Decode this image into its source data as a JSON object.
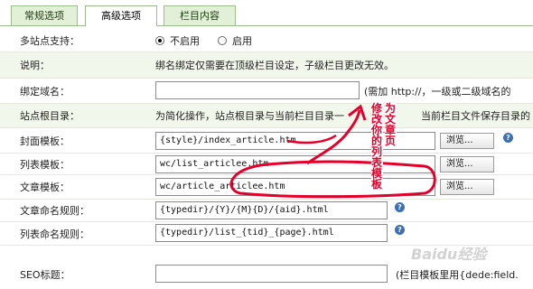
{
  "tabs": [
    "常规选项",
    "高级选项",
    "栏目内容"
  ],
  "rows": {
    "multisite": {
      "label": "多站点支持：",
      "option_off": "不启用",
      "option_on": "启用"
    },
    "note": {
      "label": "说明：",
      "text": "绑名绑定仅需要在顶级栏目设定，子级栏目更改无效。"
    },
    "bind_domain": {
      "label": "绑定域名：",
      "value": "",
      "hint": "(需加 http://，一级或二级域名的"
    },
    "site_root": {
      "label": "站点根目录：",
      "text": "为简化操作，站点根目录与当前栏目目录一",
      "text_right": "当前栏目文件保存目录的"
    },
    "cover_tpl": {
      "label": "封面模板：",
      "value": "{style}/index_article.htm",
      "browse": "浏览..."
    },
    "list_tpl": {
      "label": "列表模板：",
      "value": "wc/list_articlee.htm",
      "browse": "浏览..."
    },
    "article_tpl": {
      "label": "文章模板：",
      "value": "wc/article_articlee.htm",
      "browse": "浏览..."
    },
    "article_rule": {
      "label": "文章命名规则：",
      "value": "{typedir}/{Y}/{M}{D}/{aid}.html"
    },
    "list_rule": {
      "label": "列表命名规则：",
      "value": "{typedir}/list_{tid}_{page}.html"
    },
    "seo_title": {
      "label": "SEO标题：",
      "value": "",
      "hint": "(栏目模板里用{dede:field."
    }
  },
  "annotations": {
    "a1": "修改你的列表模板",
    "a2": "为文章页"
  },
  "watermark": "Baidu经验",
  "colors": {
    "annotation": "#e4002b",
    "row_alt": "#f1f7ea",
    "tab_bg": "#e3f0d8"
  }
}
